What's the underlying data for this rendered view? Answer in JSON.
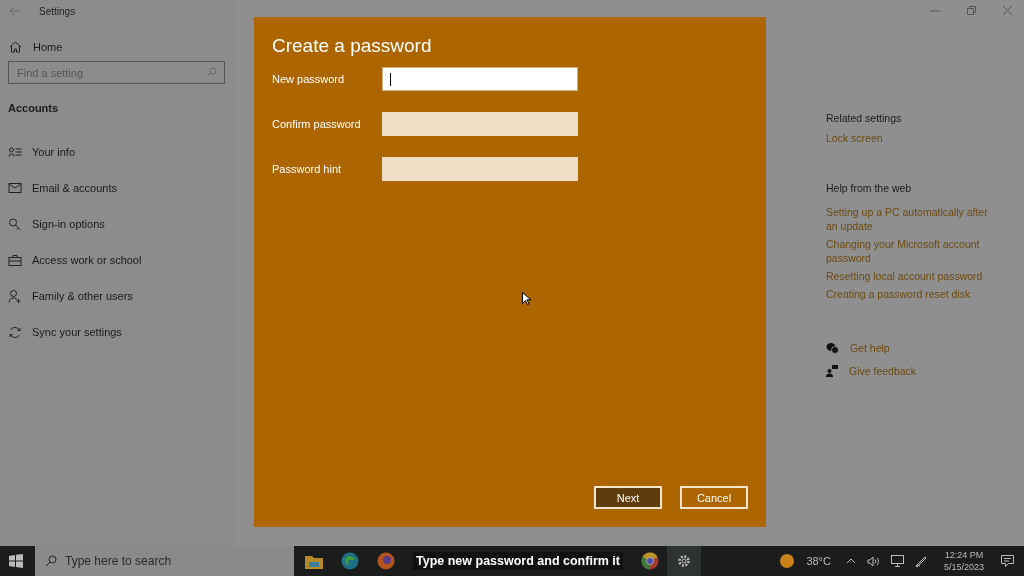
{
  "window": {
    "title": "Settings"
  },
  "sidebar": {
    "home": "Home",
    "search": {
      "placeholder": "Find a setting"
    },
    "section": "Accounts",
    "items": [
      {
        "label": "Your info",
        "selected": false
      },
      {
        "label": "Email & accounts",
        "selected": false
      },
      {
        "label": "Sign-in options",
        "selected": false
      },
      {
        "label": "Access work or school",
        "selected": false
      },
      {
        "label": "Family & other users",
        "selected": false
      },
      {
        "label": "Sync your settings",
        "selected": false
      }
    ]
  },
  "related": {
    "heading": "Related settings",
    "links": [
      "Lock screen"
    ]
  },
  "help": {
    "heading": "Help from the web",
    "links": [
      "Setting up a PC automatically after an update",
      "Changing your Microsoft account password",
      "Resetting local account password",
      "Creating a password reset disk"
    ]
  },
  "support": [
    "Get help",
    "Give feedback"
  ],
  "dialog": {
    "title": "Create a password",
    "fields": [
      {
        "label": "New password",
        "focused": true
      },
      {
        "label": "Confirm password",
        "focused": false
      },
      {
        "label": "Password hint",
        "focused": false
      }
    ],
    "buttons": [
      {
        "label": "Next",
        "primary": true
      },
      {
        "label": "Cancel",
        "primary": false
      }
    ]
  },
  "caption": "Type new password and confirm it",
  "taskbar": {
    "search": {
      "placeholder": "Type here to search"
    },
    "temperature": "38°C",
    "time": "12:24 PM",
    "date": "5/15/2023"
  }
}
